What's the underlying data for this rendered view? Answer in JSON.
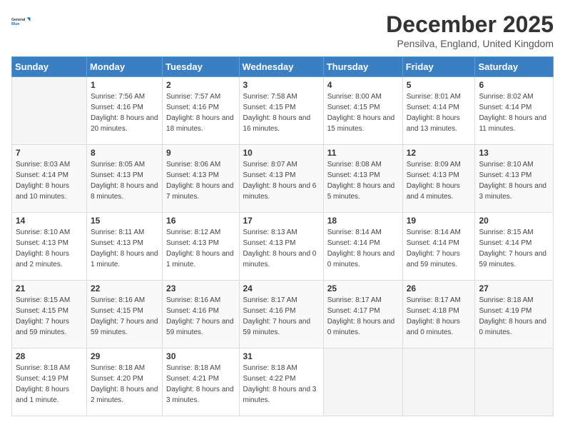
{
  "logo": {
    "line1": "General",
    "line2": "Blue"
  },
  "title": {
    "month_year": "December 2025",
    "location": "Pensilva, England, United Kingdom"
  },
  "weekdays": [
    "Sunday",
    "Monday",
    "Tuesday",
    "Wednesday",
    "Thursday",
    "Friday",
    "Saturday"
  ],
  "weeks": [
    [
      {
        "day": "",
        "sunrise": "",
        "sunset": "",
        "daylight": ""
      },
      {
        "day": "1",
        "sunrise": "Sunrise: 7:56 AM",
        "sunset": "Sunset: 4:16 PM",
        "daylight": "Daylight: 8 hours and 20 minutes."
      },
      {
        "day": "2",
        "sunrise": "Sunrise: 7:57 AM",
        "sunset": "Sunset: 4:16 PM",
        "daylight": "Daylight: 8 hours and 18 minutes."
      },
      {
        "day": "3",
        "sunrise": "Sunrise: 7:58 AM",
        "sunset": "Sunset: 4:15 PM",
        "daylight": "Daylight: 8 hours and 16 minutes."
      },
      {
        "day": "4",
        "sunrise": "Sunrise: 8:00 AM",
        "sunset": "Sunset: 4:15 PM",
        "daylight": "Daylight: 8 hours and 15 minutes."
      },
      {
        "day": "5",
        "sunrise": "Sunrise: 8:01 AM",
        "sunset": "Sunset: 4:14 PM",
        "daylight": "Daylight: 8 hours and 13 minutes."
      },
      {
        "day": "6",
        "sunrise": "Sunrise: 8:02 AM",
        "sunset": "Sunset: 4:14 PM",
        "daylight": "Daylight: 8 hours and 11 minutes."
      }
    ],
    [
      {
        "day": "7",
        "sunrise": "Sunrise: 8:03 AM",
        "sunset": "Sunset: 4:14 PM",
        "daylight": "Daylight: 8 hours and 10 minutes."
      },
      {
        "day": "8",
        "sunrise": "Sunrise: 8:05 AM",
        "sunset": "Sunset: 4:13 PM",
        "daylight": "Daylight: 8 hours and 8 minutes."
      },
      {
        "day": "9",
        "sunrise": "Sunrise: 8:06 AM",
        "sunset": "Sunset: 4:13 PM",
        "daylight": "Daylight: 8 hours and 7 minutes."
      },
      {
        "day": "10",
        "sunrise": "Sunrise: 8:07 AM",
        "sunset": "Sunset: 4:13 PM",
        "daylight": "Daylight: 8 hours and 6 minutes."
      },
      {
        "day": "11",
        "sunrise": "Sunrise: 8:08 AM",
        "sunset": "Sunset: 4:13 PM",
        "daylight": "Daylight: 8 hours and 5 minutes."
      },
      {
        "day": "12",
        "sunrise": "Sunrise: 8:09 AM",
        "sunset": "Sunset: 4:13 PM",
        "daylight": "Daylight: 8 hours and 4 minutes."
      },
      {
        "day": "13",
        "sunrise": "Sunrise: 8:10 AM",
        "sunset": "Sunset: 4:13 PM",
        "daylight": "Daylight: 8 hours and 3 minutes."
      }
    ],
    [
      {
        "day": "14",
        "sunrise": "Sunrise: 8:10 AM",
        "sunset": "Sunset: 4:13 PM",
        "daylight": "Daylight: 8 hours and 2 minutes."
      },
      {
        "day": "15",
        "sunrise": "Sunrise: 8:11 AM",
        "sunset": "Sunset: 4:13 PM",
        "daylight": "Daylight: 8 hours and 1 minute."
      },
      {
        "day": "16",
        "sunrise": "Sunrise: 8:12 AM",
        "sunset": "Sunset: 4:13 PM",
        "daylight": "Daylight: 8 hours and 1 minute."
      },
      {
        "day": "17",
        "sunrise": "Sunrise: 8:13 AM",
        "sunset": "Sunset: 4:13 PM",
        "daylight": "Daylight: 8 hours and 0 minutes."
      },
      {
        "day": "18",
        "sunrise": "Sunrise: 8:14 AM",
        "sunset": "Sunset: 4:14 PM",
        "daylight": "Daylight: 8 hours and 0 minutes."
      },
      {
        "day": "19",
        "sunrise": "Sunrise: 8:14 AM",
        "sunset": "Sunset: 4:14 PM",
        "daylight": "Daylight: 7 hours and 59 minutes."
      },
      {
        "day": "20",
        "sunrise": "Sunrise: 8:15 AM",
        "sunset": "Sunset: 4:14 PM",
        "daylight": "Daylight: 7 hours and 59 minutes."
      }
    ],
    [
      {
        "day": "21",
        "sunrise": "Sunrise: 8:15 AM",
        "sunset": "Sunset: 4:15 PM",
        "daylight": "Daylight: 7 hours and 59 minutes."
      },
      {
        "day": "22",
        "sunrise": "Sunrise: 8:16 AM",
        "sunset": "Sunset: 4:15 PM",
        "daylight": "Daylight: 7 hours and 59 minutes."
      },
      {
        "day": "23",
        "sunrise": "Sunrise: 8:16 AM",
        "sunset": "Sunset: 4:16 PM",
        "daylight": "Daylight: 7 hours and 59 minutes."
      },
      {
        "day": "24",
        "sunrise": "Sunrise: 8:17 AM",
        "sunset": "Sunset: 4:16 PM",
        "daylight": "Daylight: 7 hours and 59 minutes."
      },
      {
        "day": "25",
        "sunrise": "Sunrise: 8:17 AM",
        "sunset": "Sunset: 4:17 PM",
        "daylight": "Daylight: 8 hours and 0 minutes."
      },
      {
        "day": "26",
        "sunrise": "Sunrise: 8:17 AM",
        "sunset": "Sunset: 4:18 PM",
        "daylight": "Daylight: 8 hours and 0 minutes."
      },
      {
        "day": "27",
        "sunrise": "Sunrise: 8:18 AM",
        "sunset": "Sunset: 4:19 PM",
        "daylight": "Daylight: 8 hours and 0 minutes."
      }
    ],
    [
      {
        "day": "28",
        "sunrise": "Sunrise: 8:18 AM",
        "sunset": "Sunset: 4:19 PM",
        "daylight": "Daylight: 8 hours and 1 minute."
      },
      {
        "day": "29",
        "sunrise": "Sunrise: 8:18 AM",
        "sunset": "Sunset: 4:20 PM",
        "daylight": "Daylight: 8 hours and 2 minutes."
      },
      {
        "day": "30",
        "sunrise": "Sunrise: 8:18 AM",
        "sunset": "Sunset: 4:21 PM",
        "daylight": "Daylight: 8 hours and 3 minutes."
      },
      {
        "day": "31",
        "sunrise": "Sunrise: 8:18 AM",
        "sunset": "Sunset: 4:22 PM",
        "daylight": "Daylight: 8 hours and 3 minutes."
      },
      {
        "day": "",
        "sunrise": "",
        "sunset": "",
        "daylight": ""
      },
      {
        "day": "",
        "sunrise": "",
        "sunset": "",
        "daylight": ""
      },
      {
        "day": "",
        "sunrise": "",
        "sunset": "",
        "daylight": ""
      }
    ]
  ]
}
